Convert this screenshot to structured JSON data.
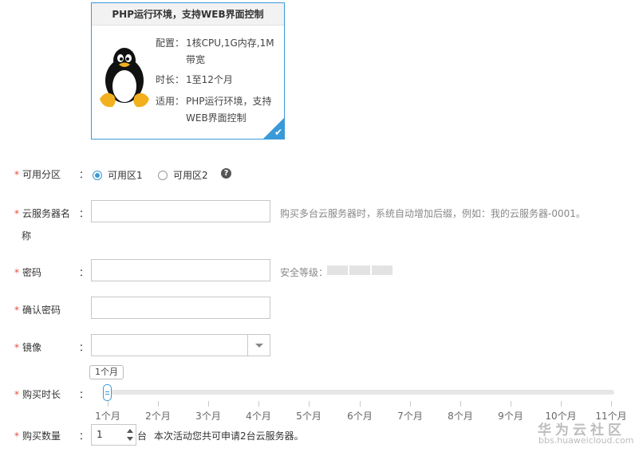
{
  "product": {
    "title": "PHP运行环境，支持WEB界面控制",
    "specs": [
      {
        "key": "配置：",
        "value": "1核CPU,1G内存,1M带宽"
      },
      {
        "key": "时长：",
        "value": "1至12个月"
      },
      {
        "key": "适用：",
        "value": "PHP运行环境，支持WEB界面控制"
      }
    ],
    "image_icon": "linux-penguin-icon",
    "selected_icon": "check-icon"
  },
  "form": {
    "colon": "：",
    "required_mark": "*",
    "zone": {
      "label": "可用分区",
      "options": [
        "可用区1",
        "可用区2"
      ],
      "selected": "可用区1",
      "help_icon": "question-circle-icon",
      "help_glyph": "?"
    },
    "server_name": {
      "label_line1": "云服务器名",
      "label_line2": "称",
      "value": "",
      "hint": "购买多台云服务器时，系统自动增加后缀，例如：我的云服务器-0001。"
    },
    "password": {
      "label": "密码",
      "value": "",
      "strength_label": "安全等级："
    },
    "confirm_password": {
      "label": "确认密码",
      "value": ""
    },
    "image": {
      "label": "镜像",
      "value": ""
    },
    "duration": {
      "label": "购买时长",
      "current": "1个月",
      "ticks": [
        "1个月",
        "2个月",
        "3个月",
        "4个月",
        "5个月",
        "6个月",
        "7个月",
        "8个月",
        "9个月",
        "10个月",
        "11个月"
      ]
    },
    "quantity": {
      "label": "购买数量",
      "value": "1",
      "unit": "台",
      "note": "本次活动您共可申请2台云服务器。"
    }
  },
  "watermark": {
    "line1": "华为云社区",
    "line2": "bbs.huaweicloud.com"
  },
  "colors": {
    "accent": "#3a9ad9",
    "required": "#e84c3d"
  }
}
